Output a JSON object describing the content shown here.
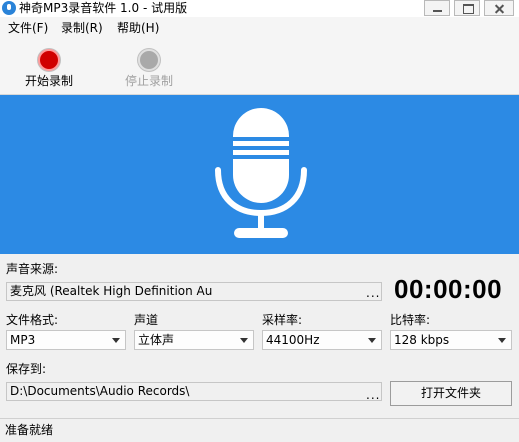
{
  "window": {
    "title": "神奇MP3录音软件 1.0 - 试用版"
  },
  "menu": [
    "文件(F)",
    "录制(R)",
    "帮助(H)"
  ],
  "toolbar": {
    "start_label": "开始录制",
    "stop_label": "停止录制",
    "stop_enabled": false
  },
  "banner": {
    "background": "#2c8ae4",
    "icon": "microphone-icon"
  },
  "source": {
    "label": "声音来源:",
    "value": "麦克风 (Realtek High Definition Au",
    "browse_label": "..."
  },
  "timer": "00:00:00",
  "format": {
    "label": "文件格式:",
    "value": "MP3"
  },
  "channel": {
    "label": "声道",
    "value": "立体声"
  },
  "sample_rate": {
    "label": "采样率:",
    "value": "44100Hz"
  },
  "bitrate": {
    "label": "比特率:",
    "value": "128 kbps"
  },
  "save": {
    "label": "保存到:",
    "path": "D:\\Documents\\Audio Records\\",
    "browse_label": "...",
    "open_folder_label": "打开文件夹"
  },
  "status": {
    "text": "准备就绪"
  }
}
